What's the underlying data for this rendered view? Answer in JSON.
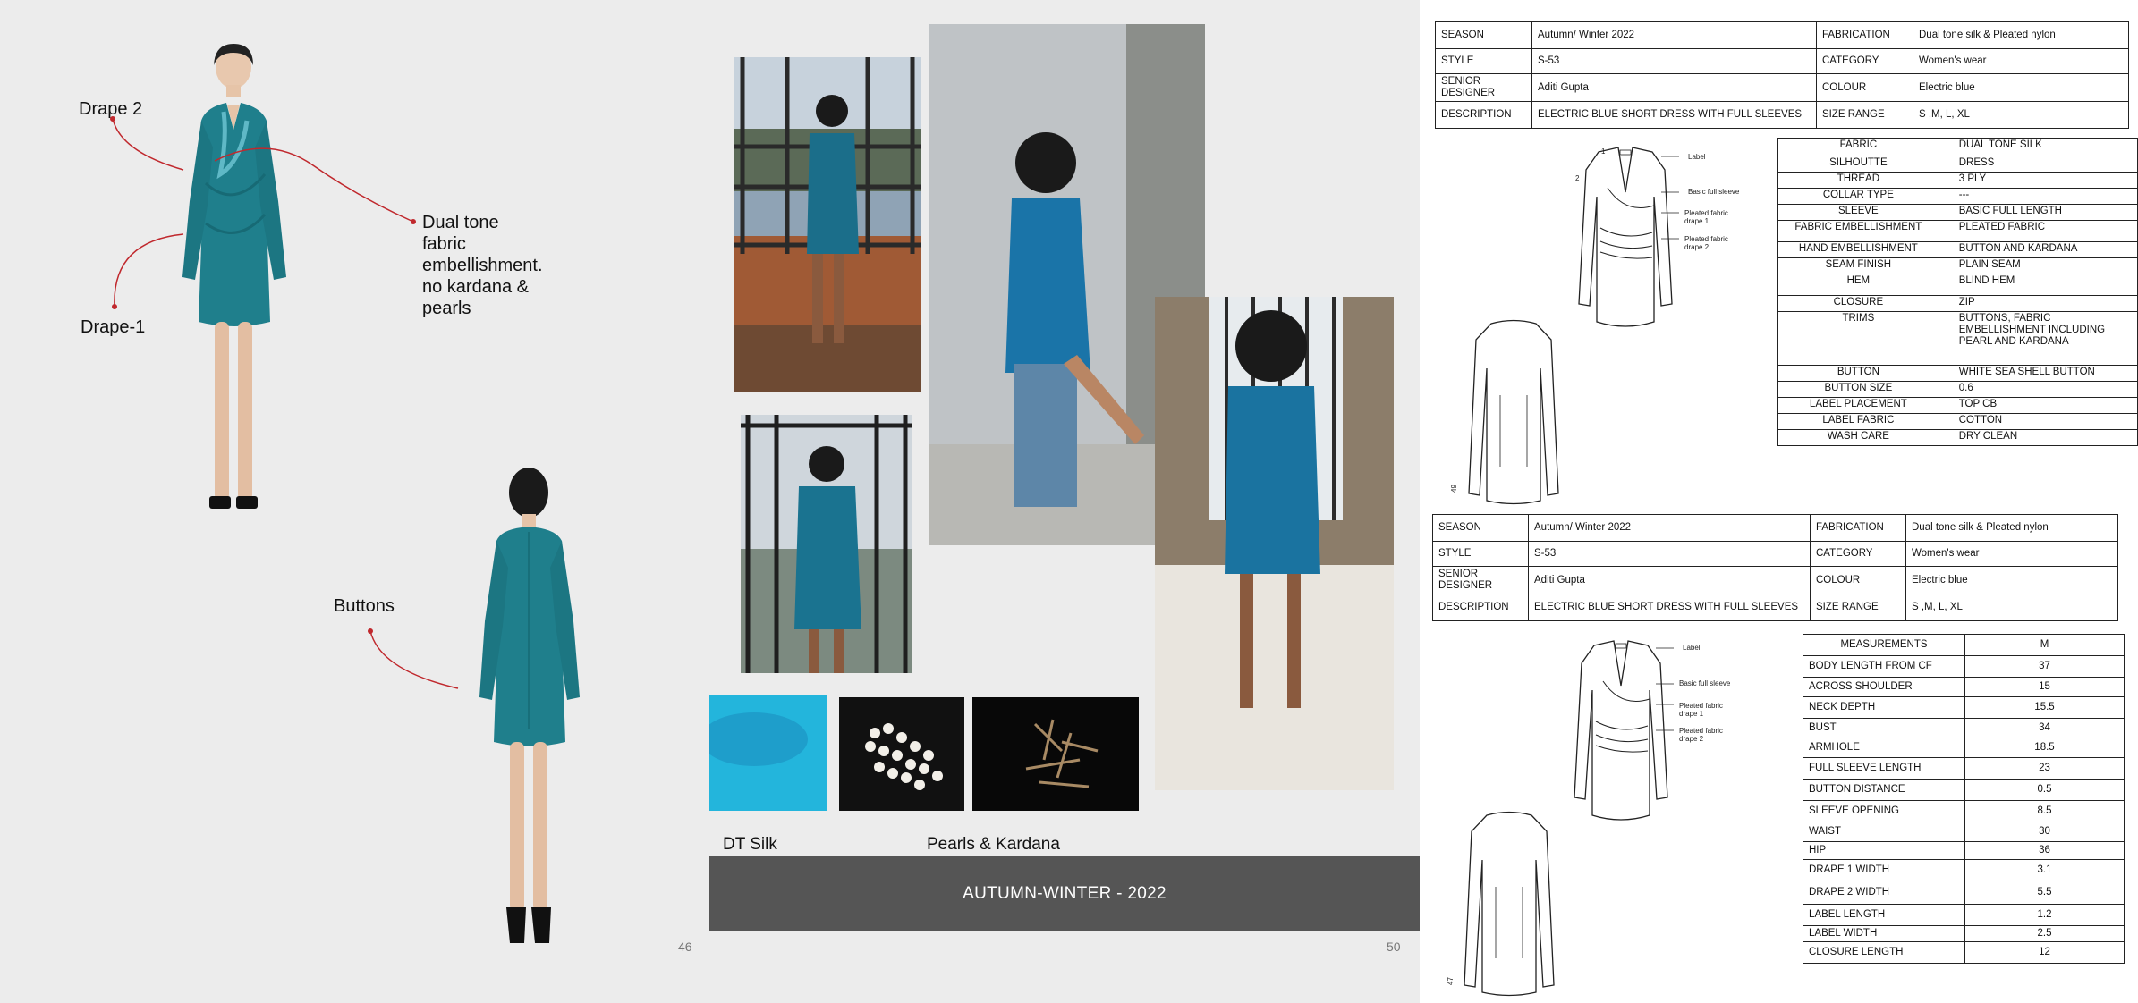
{
  "left_page": {
    "annotations": {
      "drape2": "Drape 2",
      "dual_tone": [
        "Dual tone",
        "fabric",
        "embellishment.",
        "no kardana &",
        "pearls"
      ],
      "drape1": "Drape-1",
      "buttons": "Buttons"
    },
    "page_number": "46"
  },
  "mid_page": {
    "swatch_captions": {
      "silk": "DT Silk",
      "pearls": "Pearls & Kardana"
    },
    "footer": "AUTUMN-WINTER - 2022",
    "page_number": "50"
  },
  "spec_sheet_top": {
    "season_label": "SEASON",
    "season": "Autumn/ Winter 2022",
    "fabrication_label": "FABRICATION",
    "fabrication": "Dual tone silk & Pleated nylon",
    "style_label": "STYLE",
    "style": "S-53",
    "category_label": "CATEGORY",
    "category": "Women's wear",
    "designer_label": "SENIOR DESIGNER",
    "designer": "Aditi Gupta",
    "colour_label": "COLOUR",
    "colour": "Electric blue",
    "description_label": "DESCRIPTION",
    "description": "ELECTRIC BLUE SHORT DRESS WITH FULL SLEEVES",
    "size_label": "SIZE RANGE",
    "size": "S ,M, L, XL"
  },
  "sketch_labels": {
    "label": "Label",
    "sleeve": "Basic full sleeve",
    "drape1": [
      "Pleated fabric",
      "drape 1"
    ],
    "drape2": [
      "Pleated fabric",
      "drape 2"
    ],
    "n2": "2",
    "n1": "1"
  },
  "sketch_page_numbers": {
    "top": "49",
    "bottom": "47"
  },
  "attributes": [
    {
      "k": "FABRIC",
      "v": "DUAL TONE SILK"
    },
    {
      "k": "SILHOUTTE",
      "v": "DRESS"
    },
    {
      "k": "THREAD",
      "v": "3 PLY"
    },
    {
      "k": "COLLAR TYPE",
      "v": "---"
    },
    {
      "k": "SLEEVE",
      "v": "BASIC FULL LENGTH"
    },
    {
      "k": "FABRIC EMBELLISHMENT",
      "v": "PLEATED FABRIC"
    },
    {
      "k": "HAND EMBELLISHMENT",
      "v": "BUTTON AND KARDANA"
    },
    {
      "k": "SEAM FINISH",
      "v": "PLAIN SEAM"
    },
    {
      "k": "HEM",
      "v": "BLIND HEM"
    },
    {
      "k": "CLOSURE",
      "v": "ZIP"
    },
    {
      "k": "TRIMS",
      "v": "BUTTONS, FABRIC EMBELLISHMENT INCLUDING PEARL AND KARDANA"
    },
    {
      "k": "BUTTON",
      "v": "WHITE SEA SHELL  BUTTON"
    },
    {
      "k": "BUTTON SIZE",
      "v": "0.6"
    },
    {
      "k": "LABEL PLACEMENT",
      "v": "TOP CB"
    },
    {
      "k": "LABEL FABRIC",
      "v": "COTTON"
    },
    {
      "k": "WASH CARE",
      "v": "DRY CLEAN"
    }
  ],
  "spec_sheet_bottom": {
    "season_label": "SEASON",
    "season": "Autumn/ Winter 2022",
    "fabrication_label": "FABRICATION",
    "fabrication": "Dual tone silk & Pleated nylon",
    "style_label": "STYLE",
    "style": "S-53",
    "category_label": "CATEGORY",
    "category": "Women's wear",
    "designer_label": "SENIOR DESIGNER",
    "designer": "Aditi Gupta",
    "colour_label": "COLOUR",
    "colour": "Electric blue",
    "description_label": "DESCRIPTION",
    "description": "ELECTRIC BLUE SHORT DRESS WITH FULL SLEEVES",
    "size_label": "SIZE RANGE",
    "size": "S ,M, L, XL"
  },
  "measurements": {
    "header_key": "MEASUREMENTS",
    "header_val": "M",
    "rows": [
      {
        "k": "BODY LENGTH FROM CF",
        "v": "37"
      },
      {
        "k": "ACROSS SHOULDER",
        "v": "15"
      },
      {
        "k": "NECK DEPTH",
        "v": "15.5"
      },
      {
        "k": "BUST",
        "v": "34"
      },
      {
        "k": "ARMHOLE",
        "v": "18.5"
      },
      {
        "k": "FULL SLEEVE LENGTH",
        "v": "23"
      },
      {
        "k": "BUTTON DISTANCE",
        "v": "0.5"
      },
      {
        "k": "SLEEVE OPENING",
        "v": "8.5"
      },
      {
        "k": "WAIST",
        "v": "30"
      },
      {
        "k": "HIP",
        "v": "36"
      },
      {
        "k": "DRAPE 1 WIDTH",
        "v": "3.1"
      },
      {
        "k": "DRAPE 2 WIDTH",
        "v": "5.5"
      },
      {
        "k": "LABEL LENGTH",
        "v": "1.2"
      },
      {
        "k": "LABEL WIDTH",
        "v": "2.5"
      },
      {
        "k": "CLOSURE LENGTH",
        "v": "12"
      }
    ]
  },
  "colors": {
    "dress": "#1f7f8c",
    "footer": "#555555",
    "silk_swatch": "#23b5dc"
  }
}
